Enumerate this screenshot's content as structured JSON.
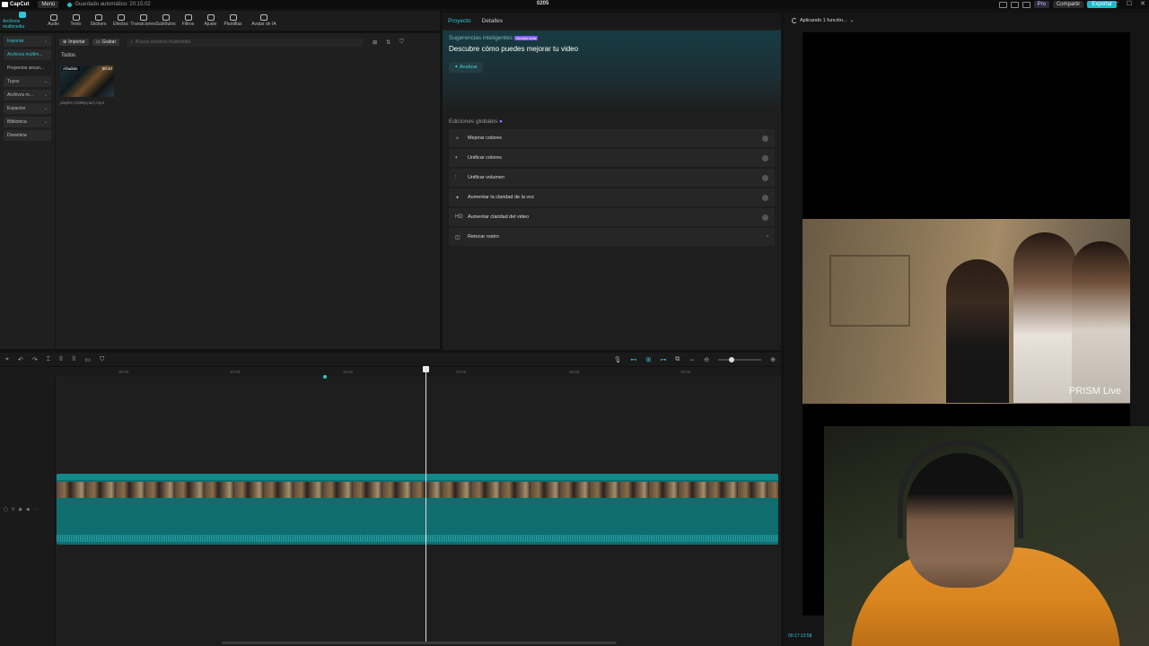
{
  "app": {
    "name": "CapCut",
    "menu_label": "Menú",
    "autosave": "Guardado automático: 20:15:02",
    "project_title": "0205"
  },
  "topbar": {
    "pro_label": "Pro",
    "share_label": "Compartir",
    "export_label": "Exportar"
  },
  "toolbar": {
    "items": [
      {
        "label": "Archivos multimedia",
        "icon": "media-icon"
      },
      {
        "label": "Audio",
        "icon": "audio-icon"
      },
      {
        "label": "Texto",
        "icon": "text-icon"
      },
      {
        "label": "Stickers",
        "icon": "sticker-icon"
      },
      {
        "label": "Efectos",
        "icon": "effects-icon"
      },
      {
        "label": "Transiciones",
        "icon": "transition-icon"
      },
      {
        "label": "Subtítulos",
        "icon": "subtitles-icon"
      },
      {
        "label": "Filtros",
        "icon": "filter-icon"
      },
      {
        "label": "Ajuste",
        "icon": "adjust-icon"
      },
      {
        "label": "Plantillas",
        "icon": "template-icon"
      },
      {
        "label": "Avatar de IA",
        "icon": "avatar-icon"
      }
    ]
  },
  "sidebar": {
    "items": [
      {
        "label": "Importar",
        "chev": "⌄"
      },
      {
        "label": "Archivos multim..."
      },
      {
        "label": "Proyectos secun..."
      },
      {
        "label": "Tuyos",
        "chev": "⌄"
      },
      {
        "label": "Archivos m...",
        "chev": "⌄"
      },
      {
        "label": "Espacios",
        "chev": "⌄"
      },
      {
        "label": "Biblioteca",
        "chev": "⌄"
      },
      {
        "label": "Dreamina"
      }
    ]
  },
  "media": {
    "import_label": "Importar",
    "record_label": "Grabar",
    "search_placeholder": "Buscar archivos multimedia",
    "filter_label": "Todos",
    "item": {
      "badge": "Añadido",
      "duration": "00:40",
      "name": "playlist (1080p.pac).mp4"
    }
  },
  "project_panel": {
    "tabs": [
      "Proyecto",
      "Detalles"
    ],
    "smart_label": "Sugerencias inteligentes",
    "beta_badge": "Versión beta",
    "smart_title": "Descubre cómo puedes mejorar tu video",
    "analyze_label": "Analizar",
    "global_title": "Ediciones globales",
    "global_items": [
      {
        "icon": "✧",
        "label": "Mejorar colores"
      },
      {
        "icon": "◐",
        "label": "Unificar colores"
      },
      {
        "icon": "⫶",
        "label": "Unificar volumen"
      },
      {
        "icon": "✦",
        "label": "Aumentar la claridad de la voz"
      },
      {
        "icon": "HD",
        "label": "Aumentar claridad del video"
      },
      {
        "icon": "◫",
        "label": "Retocar rostro"
      }
    ]
  },
  "preview": {
    "status": "Aplicando 1 función...",
    "watermark": "PRISM Live",
    "timecode": "00:17:13:58"
  },
  "timeline": {
    "ticks": [
      "00:00",
      "10:00",
      "15:00",
      "20:00",
      "25:00",
      "30:00"
    ]
  },
  "colors": {
    "accent": "#2fc7d6",
    "clip": "#0f6d6f",
    "export": "#20b9c9"
  }
}
